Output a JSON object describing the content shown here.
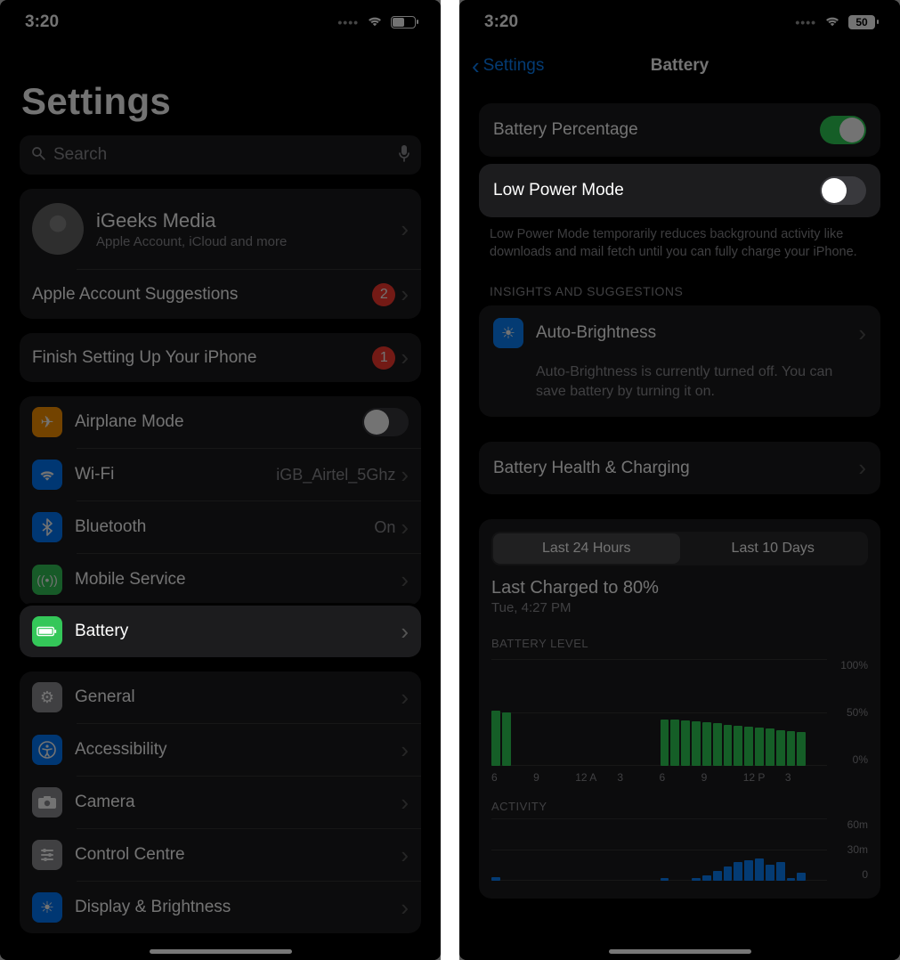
{
  "status": {
    "time": "3:20",
    "battery_pct": "50"
  },
  "panel1": {
    "title": "Settings",
    "search_placeholder": "Search",
    "profile": {
      "name": "iGeeks Media",
      "sub": "Apple Account, iCloud and more"
    },
    "suggestions_row": {
      "label": "Apple Account Suggestions",
      "badge": "2"
    },
    "finish_row": {
      "label": "Finish Setting Up Your iPhone",
      "badge": "1"
    },
    "group1": [
      {
        "icon": "airplane-icon",
        "color": "ic-orange",
        "label": "Airplane Mode",
        "toggle": false
      },
      {
        "icon": "wifi-icon",
        "color": "ic-blue",
        "label": "Wi-Fi",
        "value": "iGB_Airtel_5Ghz"
      },
      {
        "icon": "bluetooth-icon",
        "color": "ic-blue",
        "label": "Bluetooth",
        "value": "On"
      },
      {
        "icon": "mobile-icon",
        "color": "ic-green",
        "label": "Mobile Service"
      }
    ],
    "battery_row": {
      "label": "Battery"
    },
    "group2": [
      {
        "icon": "gear-icon",
        "color": "ic-grey",
        "label": "General"
      },
      {
        "icon": "accessibility-icon",
        "color": "ic-blue",
        "label": "Accessibility"
      },
      {
        "icon": "camera-icon",
        "color": "ic-grey",
        "label": "Camera"
      },
      {
        "icon": "control-icon",
        "color": "ic-grey",
        "label": "Control Centre"
      },
      {
        "icon": "brightness-icon",
        "color": "ic-blue",
        "label": "Display & Brightness"
      }
    ]
  },
  "panel2": {
    "back_label": "Settings",
    "title": "Battery",
    "percentage_row": {
      "label": "Battery Percentage",
      "on": true
    },
    "lowpower_row": {
      "label": "Low Power Mode",
      "on": false
    },
    "lowpower_hint": "Low Power Mode temporarily reduces background activity like downloads and mail fetch until you can fully charge your iPhone.",
    "section_head": "INSIGHTS AND SUGGESTIONS",
    "insight": {
      "title": "Auto-Brightness",
      "body": "Auto-Brightness is currently turned off. You can save battery by turning it on."
    },
    "health_row": {
      "label": "Battery Health & Charging"
    },
    "seg": {
      "a": "Last 24 Hours",
      "b": "Last 10 Days"
    },
    "charge_title": "Last Charged to 80%",
    "charge_sub": "Tue, 4:27 PM",
    "level_label": "BATTERY LEVEL",
    "activity_label": "ACTIVITY",
    "y_level": [
      "100%",
      "50%",
      "0%"
    ],
    "x_ticks": [
      "6",
      "9",
      "12 A",
      "3",
      "6",
      "9",
      "12 P",
      "3"
    ],
    "y_activity": [
      "60m",
      "30m",
      "0"
    ]
  },
  "chart_data": [
    {
      "type": "bar",
      "title": "BATTERY LEVEL",
      "ylabel": "%",
      "ylim": [
        0,
        100
      ],
      "categories": [
        "6",
        "",
        "",
        "9",
        "",
        "",
        "12A",
        "",
        "",
        "3",
        "",
        "",
        "6",
        "",
        "",
        "9",
        "",
        "",
        "12P",
        "",
        "",
        "3",
        "",
        ""
      ],
      "values": [
        52,
        50,
        0,
        0,
        0,
        0,
        0,
        0,
        0,
        0,
        0,
        0,
        0,
        0,
        0,
        0,
        44,
        44,
        43,
        42,
        41,
        40,
        39,
        38,
        37,
        36,
        35,
        34,
        33,
        32,
        0,
        0
      ]
    },
    {
      "type": "bar",
      "title": "ACTIVITY",
      "ylabel": "minutes",
      "ylim": [
        0,
        60
      ],
      "categories": [
        "6",
        "",
        "",
        "9",
        "",
        "",
        "12A",
        "",
        "",
        "3",
        "",
        "",
        "6",
        "",
        "",
        "9",
        "",
        "",
        "12P",
        "",
        "",
        "3",
        "",
        ""
      ],
      "values": [
        4,
        0,
        0,
        0,
        0,
        0,
        0,
        0,
        0,
        0,
        0,
        0,
        0,
        0,
        0,
        0,
        3,
        0,
        0,
        3,
        5,
        10,
        14,
        18,
        20,
        22,
        16,
        18,
        3,
        8,
        0,
        0
      ]
    }
  ]
}
